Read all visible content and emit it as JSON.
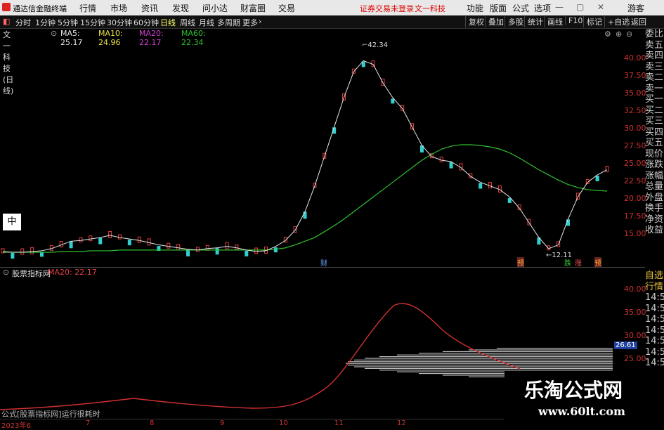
{
  "titlebar": {
    "app_title": "通达信金融终端",
    "menus": [
      "行情",
      "市场",
      "资讯",
      "发现",
      "问小达",
      "财富圈",
      "交易"
    ],
    "warning": "证券交易未登录",
    "brand": "文一科技",
    "right_menus": [
      "功能",
      "版面",
      "公式",
      "选项"
    ],
    "guest": "游客"
  },
  "periods": [
    "分时",
    "1分钟",
    "5分钟",
    "15分钟",
    "30分钟",
    "60分钟",
    "日线",
    "周线",
    "月线",
    "多周期",
    "更多"
  ],
  "active_period": "日线",
  "tools": [
    "复权",
    "叠加",
    "多股",
    "统计",
    "画线",
    "F10",
    "标记",
    "+自选",
    "返回"
  ],
  "ma_legend": {
    "stock": "文一科技(日线)",
    "ma5": "MA5: 25.17",
    "ma10": "MA10: 24.96",
    "ma20": "MA20: 22.17",
    "ma60": "MA60: 22.34"
  },
  "colors": {
    "ma5": "#e8e8e8",
    "ma10": "#e8e040",
    "ma20": "#d040d0",
    "ma60": "#30c030",
    "up": "#e04040",
    "down": "#30d0d0"
  },
  "main_axis": [
    "40.00",
    "37.50",
    "35.00",
    "32.50",
    "30.00",
    "27.50",
    "25.00",
    "22.50",
    "20.00",
    "17.50",
    "15.00"
  ],
  "price_annotations": {
    "high": "42.34",
    "low": "12.11"
  },
  "event_tags": [
    "财",
    "预",
    "跌",
    "涨",
    "预"
  ],
  "zhong_label": "中",
  "sidebar_items": [
    "委比",
    "卖五",
    "卖四",
    "卖三",
    "卖二",
    "卖一",
    "买一",
    "买二",
    "买三",
    "买四",
    "买五",
    "现价",
    "涨跌",
    "涨幅",
    "总量",
    "外盘",
    "换手",
    "净资",
    "收益"
  ],
  "sidebar2_items": [
    "自选",
    "行情",
    "14:56",
    "14:56",
    "14:56",
    "14:56",
    "14:56",
    "14:56",
    "14:56"
  ],
  "indicator": {
    "name": "股票指标网",
    "ma": "MA20: 22.17",
    "axis": [
      "40.00",
      "35.00",
      "30.00",
      "25.00"
    ],
    "current": "26.61"
  },
  "status": "公式[股票指标网]运行很耗时",
  "x_axis": {
    "start": "2023年6",
    "months": [
      "7",
      "8",
      "9",
      "10",
      "11",
      "12"
    ]
  },
  "watermark": {
    "title": "乐淘公式网",
    "url": "www.60lt.com"
  },
  "chart_data": {
    "type": "candlestick",
    "y_range": [
      12,
      43
    ],
    "ma5": [
      14.1,
      14.0,
      14.0,
      14.1,
      14.2,
      14.5,
      15.0,
      15.5,
      15.6,
      15.8,
      16.0,
      16.3,
      16.0,
      15.8,
      15.6,
      15.3,
      15.0,
      14.8,
      14.6,
      14.4,
      14.3,
      14.5,
      14.6,
      14.8,
      14.6,
      14.3,
      14.1,
      14.2,
      14.8,
      15.6,
      17.0,
      19.5,
      23.0,
      27.0,
      31.0,
      35.0,
      38.5,
      40.0,
      39.5,
      37.0,
      35.0,
      33.5,
      31.0,
      28.5,
      27.0,
      26.5,
      26.3,
      25.5,
      24.3,
      23.5,
      23.0,
      22.5,
      21.5,
      20.0,
      18.0,
      16.0,
      14.5,
      15.0,
      18.5,
      21.5,
      23.5,
      24.5,
      25.2
    ],
    "ma60": [
      14.0,
      14.0,
      14.0,
      14.0,
      14.0,
      14.0,
      14.1,
      14.1,
      14.1,
      14.2,
      14.2,
      14.2,
      14.3,
      14.3,
      14.3,
      14.3,
      14.3,
      14.3,
      14.3,
      14.3,
      14.3,
      14.3,
      14.3,
      14.3,
      14.3,
      14.3,
      14.3,
      14.3,
      14.4,
      14.6,
      15.0,
      15.5,
      16.0,
      16.8,
      17.6,
      18.5,
      19.5,
      20.5,
      21.5,
      22.5,
      23.5,
      24.5,
      25.5,
      26.5,
      27.3,
      28.0,
      28.4,
      28.6,
      28.6,
      28.5,
      28.3,
      28.0,
      27.5,
      26.8,
      26.0,
      25.2,
      24.5,
      23.8,
      23.2,
      22.8,
      22.5,
      22.4,
      22.3
    ]
  }
}
